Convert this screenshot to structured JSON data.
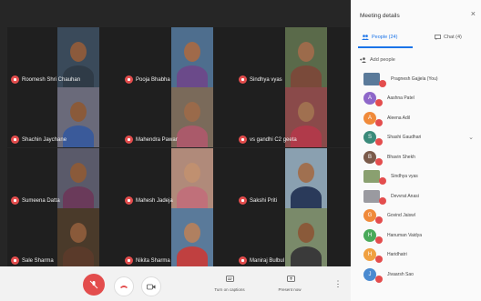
{
  "tiles": [
    {
      "name": "Roomesh Shri Chauhan",
      "bg": "#3a4a5a",
      "skin": "#8b5a3c",
      "shirt": "#2f3b47"
    },
    {
      "name": "Pooja Bhabha",
      "bg": "#4e6e8e",
      "skin": "#a06a4a",
      "shirt": "#6b4a8a"
    },
    {
      "name": "Sindhya vyas",
      "bg": "#5a6a4a",
      "skin": "#9c6b4b",
      "shirt": "#7a4a3a"
    },
    {
      "name": "Shachin Jaychane",
      "bg": "#6a6a7a",
      "skin": "#8a5a3a",
      "shirt": "#3a5a9a"
    },
    {
      "name": "Mahendra Pawar",
      "bg": "#7a6a5a",
      "skin": "#9a6a4a",
      "shirt": "#aa5a6a"
    },
    {
      "name": "vs gandhi C2 geeta",
      "bg": "#8a4a4a",
      "skin": "#a07050",
      "shirt": "#b03a4a"
    },
    {
      "name": "Sumeena Datta",
      "bg": "#5a5a6a",
      "skin": "#8a5a3a",
      "shirt": "#6a3a5a"
    },
    {
      "name": "Mahesh Jadeja",
      "bg": "#b08a7a",
      "skin": "#c09070",
      "shirt": "#c0707a"
    },
    {
      "name": "Sakshi Priti",
      "bg": "#8aa0b0",
      "skin": "#a07050",
      "shirt": "#2a3a5a"
    },
    {
      "name": "Sale Sharma",
      "bg": "#4a3a2a",
      "skin": "#8a5a3a",
      "shirt": "#5a3a2a"
    },
    {
      "name": "Nikita Sharma",
      "bg": "#5a7a9a",
      "skin": "#b08060",
      "shirt": "#c04040"
    },
    {
      "name": "Maniraj Bulbul",
      "bg": "#7a8a6a",
      "skin": "#8a5a3a",
      "shirt": "#3a3a3a"
    }
  ],
  "toolbar": {
    "captions_label": "Turn on captions",
    "present_label": "Present now",
    "more_glyph": "⋮"
  },
  "panel": {
    "title": "Meeting details",
    "close_glyph": "×",
    "tab_people": "People (24)",
    "tab_chat": "Chat (4)",
    "add_people": "Add people",
    "participants": [
      {
        "name": "Pragnesh Gajjela (You)",
        "initial": "",
        "color": "#5a7a9a",
        "photo": true
      },
      {
        "name": "Aashna Patel",
        "initial": "A",
        "color": "#8e67c9"
      },
      {
        "name": "Aleena Adil",
        "initial": "A",
        "color": "#f08a3a"
      },
      {
        "name": "Shashi Gaudhari",
        "initial": "S",
        "color": "#3a8a7a",
        "chevron": true
      },
      {
        "name": "Bhavin Shekh",
        "initial": "B",
        "color": "#7a5a4a"
      },
      {
        "name": "Sindhya vyas",
        "initial": "",
        "color": "#8aa070",
        "photo": true
      },
      {
        "name": "Devvrat Anasi",
        "initial": "",
        "color": "#9a9aa0",
        "photo": true
      },
      {
        "name": "Govind Jaiswl",
        "initial": "G",
        "color": "#f08a3a"
      },
      {
        "name": "Hanuman Vaidya",
        "initial": "H",
        "color": "#4aaa5a"
      },
      {
        "name": "Haridhatri",
        "initial": "H",
        "color": "#f0a040"
      },
      {
        "name": "Jivaarsh Sao",
        "initial": "J",
        "color": "#4a8ad0"
      }
    ]
  }
}
